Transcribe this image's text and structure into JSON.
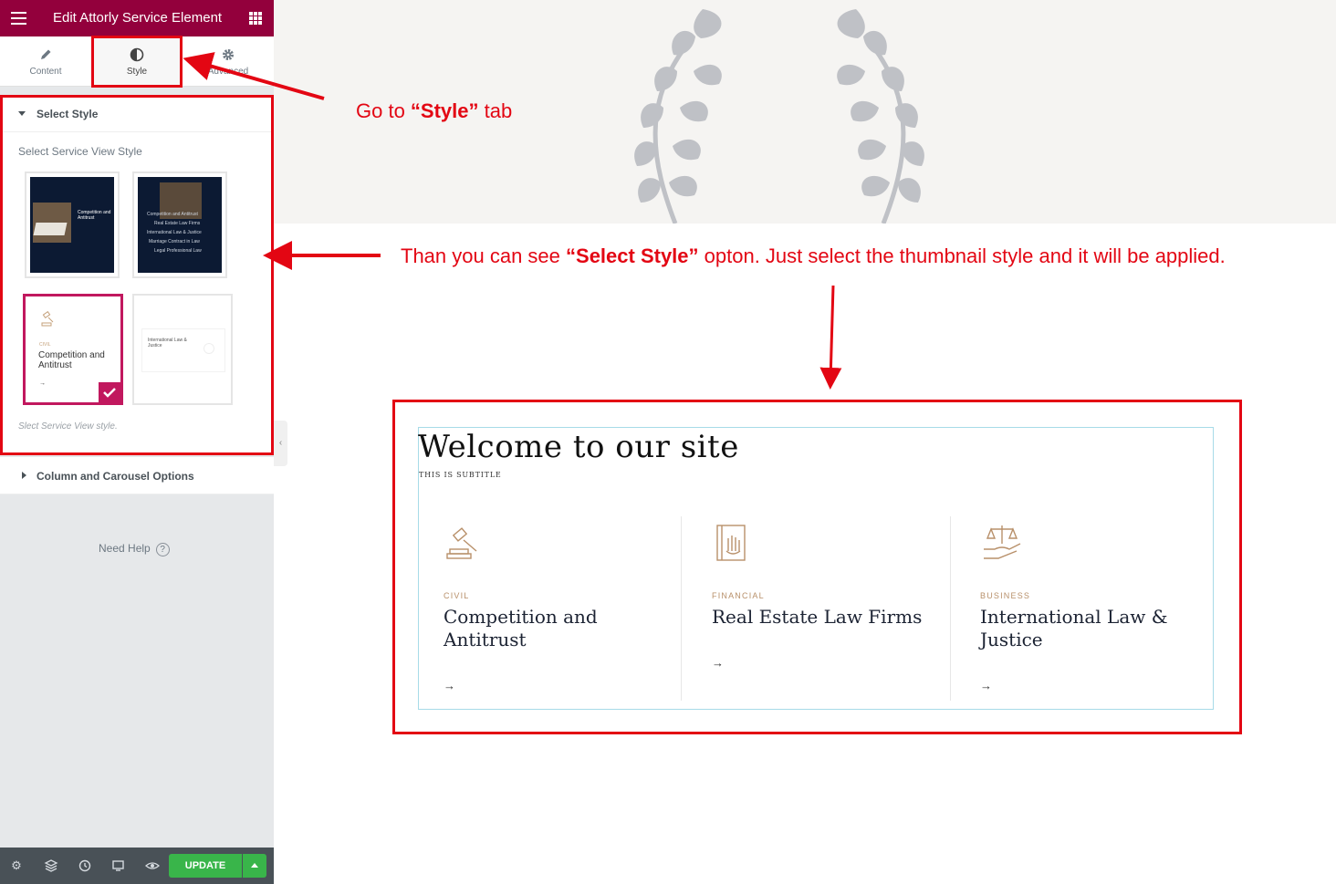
{
  "panel": {
    "title": "Edit Attorly Service Element",
    "tabs": [
      {
        "label": "Content",
        "icon": "pencil-icon"
      },
      {
        "label": "Style",
        "icon": "half-circle-icon",
        "active": true
      },
      {
        "label": "Advanced",
        "icon": "gear-icon"
      }
    ],
    "select_style": {
      "heading": "Select Style",
      "field_label": "Select Service View Style",
      "note": "Slect Service View style.",
      "thumbs": [
        {
          "title": "Competition and Antitrust"
        },
        {
          "items": [
            "Competition and Antitrust",
            "Real Estate Law Firms",
            "International Law & Justice",
            "Marriage Contract in Law",
            "Legal Professional Law"
          ]
        },
        {
          "category": "CIVIL",
          "title": "Competition and Antitrust",
          "selected": true
        },
        {
          "title": "International Law & Justice"
        }
      ]
    },
    "column_section": "Column and Carousel Options",
    "need_help": "Need Help",
    "update_label": "UPDATE"
  },
  "canvas": {
    "title": "Welcome to our site",
    "subtitle": "THIS IS SUBTITLE",
    "cards": [
      {
        "category": "CIVIL",
        "title": "Competition and Antitrust",
        "icon": "gavel-icon"
      },
      {
        "category": "FINANCIAL",
        "title": "Real Estate Law Firms",
        "icon": "law-book-icon"
      },
      {
        "category": "BUSINESS",
        "title": "International Law & Justice",
        "icon": "scales-hand-icon"
      }
    ]
  },
  "annotations": {
    "tab_hint_prefix": "Go  to ",
    "tab_hint_bold": "“Style”",
    "tab_hint_suffix": " tab",
    "style_hint_prefix": "Than you  can see ",
    "style_hint_bold": "“Select Style”",
    "style_hint_suffix": " opton. Just select the thumbnail style and it will be applied.",
    "color": "#e30613"
  },
  "colors": {
    "header": "#93003c",
    "accent": "#c1185e",
    "update": "#39b54a",
    "footer": "#495157"
  }
}
